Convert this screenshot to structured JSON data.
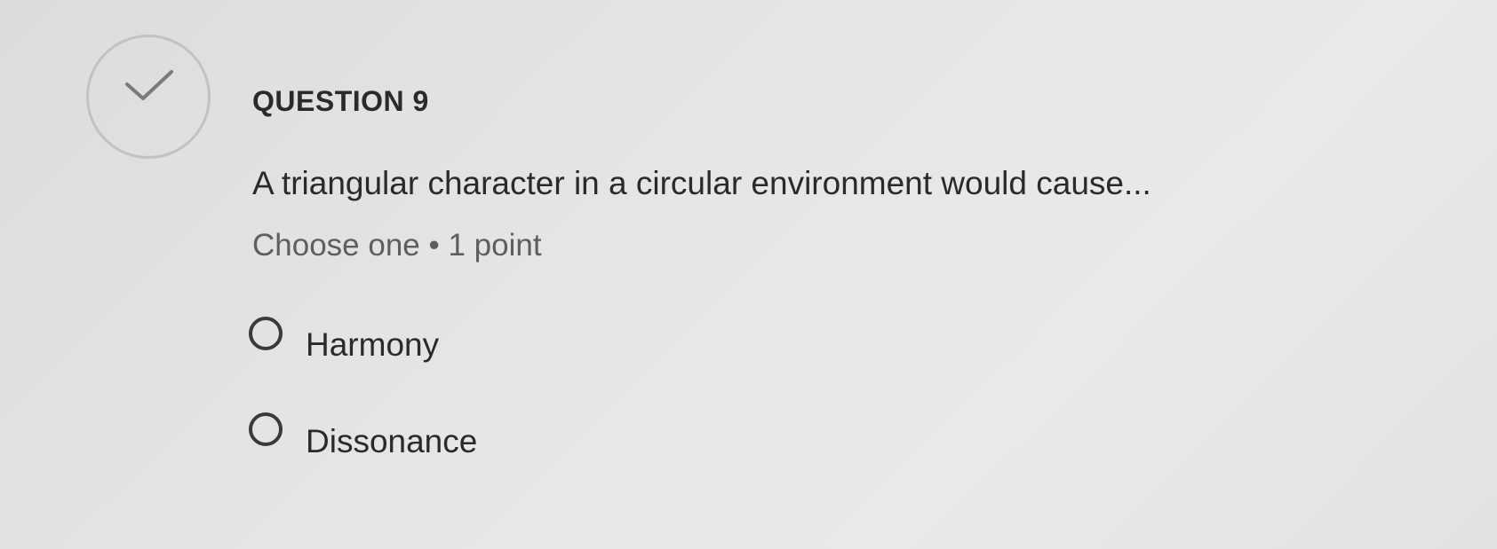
{
  "question": {
    "status_icon": "check-icon",
    "number_label": "QUESTION 9",
    "text": "A triangular character in a circular environment would cause...",
    "meta": "Choose one • 1 point",
    "options": [
      {
        "label": "Harmony",
        "selected": false
      },
      {
        "label": "Dissonance",
        "selected": false
      }
    ]
  },
  "colors": {
    "background": "#e4e4e2",
    "text": "#2a2a2a",
    "meta_text": "#5e5e5e",
    "status_circle_border": "#c2c2c0",
    "check_stroke": "#7a7a7a"
  }
}
